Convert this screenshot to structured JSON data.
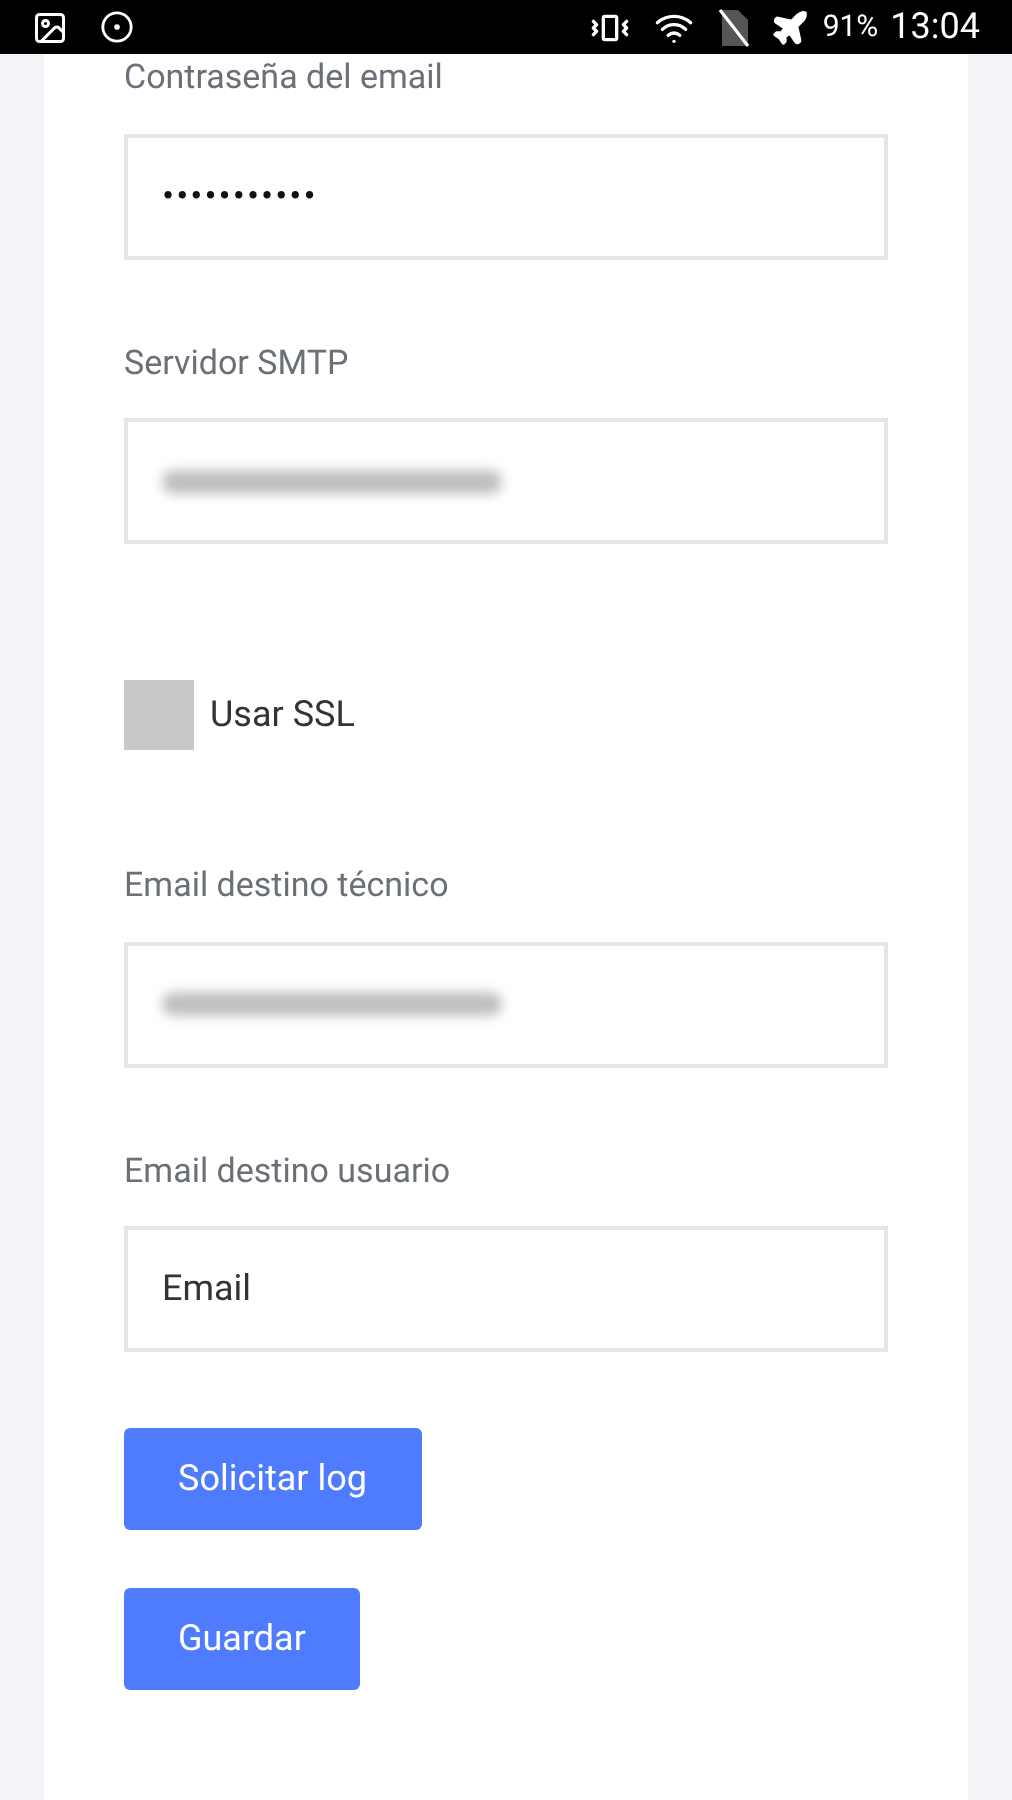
{
  "status_bar": {
    "battery": "91%",
    "time": "13:04"
  },
  "fields": [
    {
      "label": "Contraseña del email",
      "kind": "text",
      "value": "•••••••••••"
    },
    {
      "label": "Servidor SMTP",
      "kind": "redacted"
    },
    {
      "kind": "checkbox",
      "label": "Usar SSL",
      "checked": false
    },
    {
      "label": "Email destino técnico",
      "kind": "redacted"
    },
    {
      "label": "Email destino usuario",
      "kind": "text",
      "placeholder": "Email"
    }
  ],
  "buttons": [
    "Solicitar log",
    "Guardar"
  ]
}
